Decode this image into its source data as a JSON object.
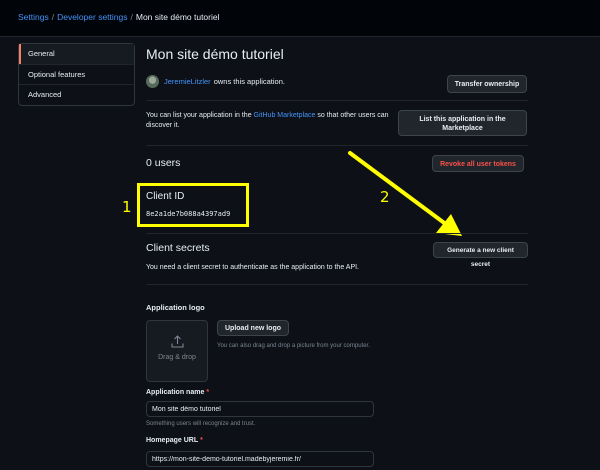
{
  "breadcrumb": {
    "items": [
      "Settings",
      "Developer settings"
    ],
    "current": "Mon site démo tutoriel",
    "separator": "/"
  },
  "sidebar": {
    "items": [
      {
        "label": "General",
        "active": true
      },
      {
        "label": "Optional features",
        "active": false
      },
      {
        "label": "Advanced",
        "active": false
      }
    ]
  },
  "app": {
    "title": "Mon site démo tutoriel",
    "owner_name": "JeremieLitzler",
    "owner_suffix": "owns this application.",
    "transfer_button": "Transfer ownership",
    "marketplace_text_before": "You can list your application in the",
    "marketplace_link": "GitHub Marketplace",
    "marketplace_text_after": "so that other users can discover it.",
    "list_button": "List this application in the Marketplace",
    "users_count": "0 users",
    "revoke_button": "Revoke all user tokens"
  },
  "client_id": {
    "label": "Client ID",
    "value": "8e2a1de7b088a4397ad9"
  },
  "client_secrets": {
    "title": "Client secrets",
    "generate_button": "Generate a new client secret",
    "description": "You need a client secret to authenticate as the application to the API."
  },
  "logo": {
    "label": "Application logo",
    "drag_drop": "Drag & drop",
    "upload_button": "Upload new logo",
    "hint": "You can also drag and drop a picture from your computer."
  },
  "form": {
    "app_name_label": "Application name",
    "app_name_value": "Mon site démo tutoriel",
    "app_name_hint": "Something users will recognize and trust.",
    "homepage_label": "Homepage URL",
    "homepage_value": "https://mon-site-demo-tutoriel.madebyjeremie.fr/",
    "required_marker": "*"
  },
  "annotations": {
    "marker_1": "1",
    "marker_2": "2",
    "highlight_color": "#ffff00"
  },
  "colors": {
    "background": "#0d1117",
    "link": "#4493f8",
    "danger": "#f85149",
    "active_tab_accent": "#f78166"
  }
}
